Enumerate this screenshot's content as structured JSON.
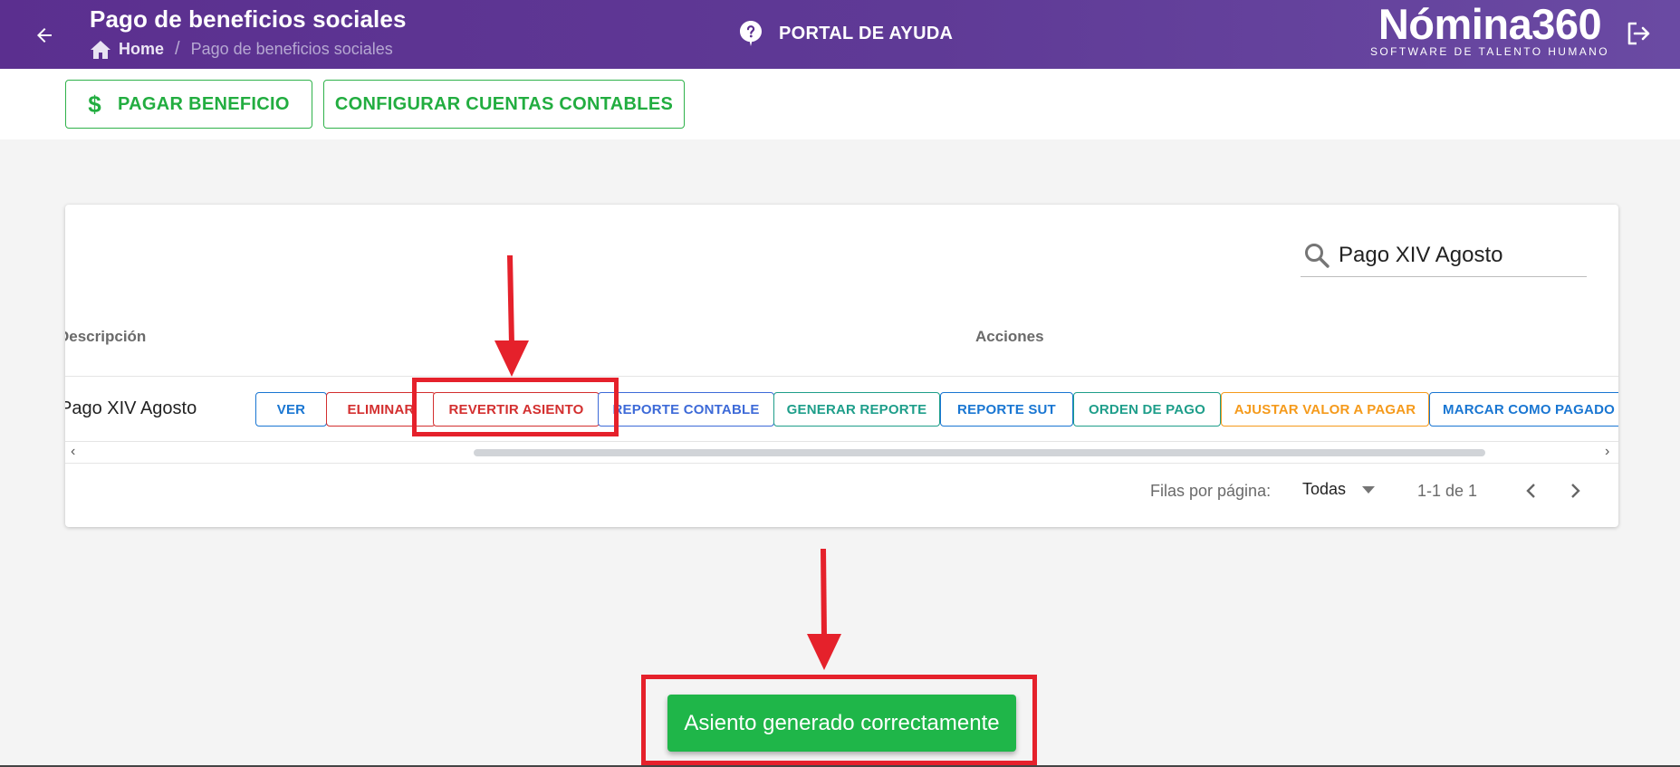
{
  "header": {
    "title": "Pago de beneficios sociales",
    "breadcrumb": {
      "home": "Home",
      "current": "Pago de beneficios sociales"
    },
    "help_label": "PORTAL DE AYUDA",
    "brand": {
      "logo": "Nómina360",
      "tagline": "SOFTWARE DE TALENTO HUMANO"
    }
  },
  "toolbar": {
    "pay_label": "PAGAR BENEFICIO",
    "config_label": "CONFIGURAR CUENTAS CONTABLES"
  },
  "table": {
    "search": {
      "value": "Pago XIV Agosto"
    },
    "columns": [
      "Descripción",
      "Acciones"
    ],
    "rows": [
      {
        "description": "Pago XIV Agosto"
      }
    ],
    "actions": [
      "VER",
      "ELIMINAR",
      "REVERTIR ASIENTO",
      "REPORTE CONTABLE",
      "GENERAR REPORTE",
      "REPORTE SUT",
      "ORDEN DE PAGO",
      "AJUSTAR VALOR A PAGAR",
      "MARCAR COMO PAGADO"
    ],
    "footer": {
      "rows_per_page_label": "Filas por página:",
      "rows_per_page_value": "Todas",
      "range": "1-1 de 1"
    }
  },
  "toast": {
    "message": "Asiento generado correctamente"
  },
  "colors": {
    "header": "#5b2f8f",
    "primary_green": "#22ad40",
    "annotation_red": "#e5212b"
  }
}
